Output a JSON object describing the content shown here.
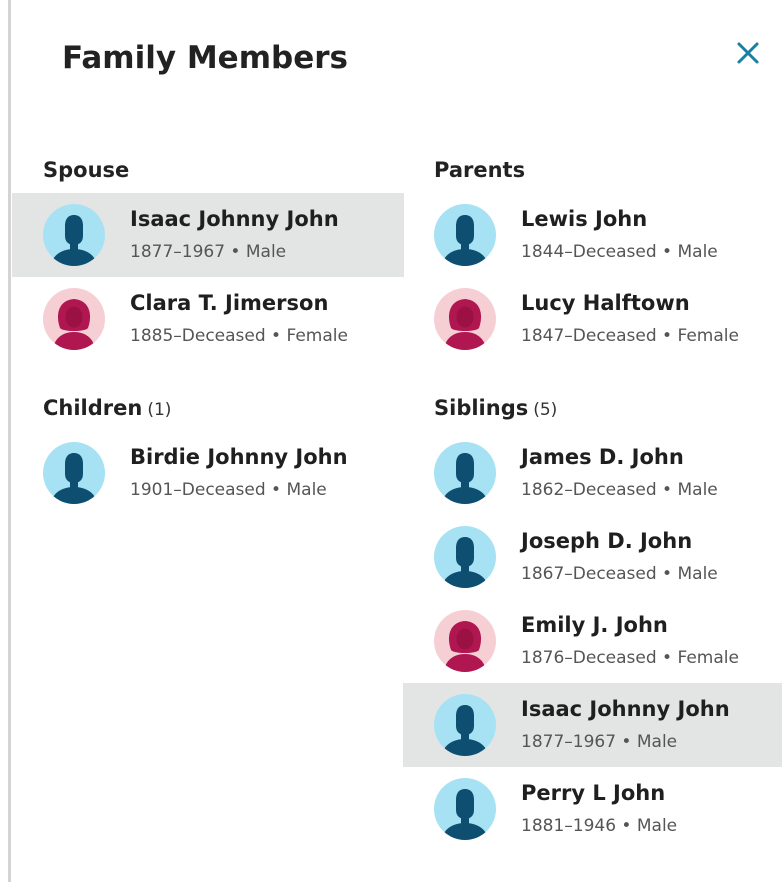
{
  "header": {
    "title": "Family Members",
    "close_icon": "close-icon"
  },
  "colors": {
    "accent": "#1a7fa6",
    "selected_bg": "#e3e5e4",
    "male_bg": "#a6e2f3",
    "male_fg": "#0e4f71",
    "female_bg": "#f6cfd4",
    "female_fg": "#b0164f"
  },
  "spouse": {
    "label": "Spouse",
    "members": [
      {
        "name": "Isaac Johnny John",
        "details": "1877–1967 • Male",
        "gender": "male",
        "selected": true
      },
      {
        "name": "Clara T. Jimerson",
        "details": "1885–Deceased • Female",
        "gender": "female",
        "selected": false
      }
    ]
  },
  "children": {
    "label": "Children",
    "count": "(1)",
    "members": [
      {
        "name": "Birdie Johnny John",
        "details": "1901–Deceased • Male",
        "gender": "male",
        "selected": false
      }
    ]
  },
  "parents": {
    "label": "Parents",
    "members": [
      {
        "name": "Lewis John",
        "details": "1844–Deceased • Male",
        "gender": "male",
        "selected": false
      },
      {
        "name": "Lucy Halftown",
        "details": "1847–Deceased • Female",
        "gender": "female",
        "selected": false
      }
    ]
  },
  "siblings": {
    "label": "Siblings",
    "count": "(5)",
    "members": [
      {
        "name": "James D. John",
        "details": "1862–Deceased • Male",
        "gender": "male",
        "selected": false
      },
      {
        "name": "Joseph D. John",
        "details": "1867–Deceased • Male",
        "gender": "male",
        "selected": false
      },
      {
        "name": "Emily J. John",
        "details": "1876–Deceased • Female",
        "gender": "female",
        "selected": false
      },
      {
        "name": "Isaac Johnny John",
        "details": "1877–1967 • Male",
        "gender": "male",
        "selected": true
      },
      {
        "name": "Perry L John",
        "details": "1881–1946 • Male",
        "gender": "male",
        "selected": false
      }
    ]
  }
}
